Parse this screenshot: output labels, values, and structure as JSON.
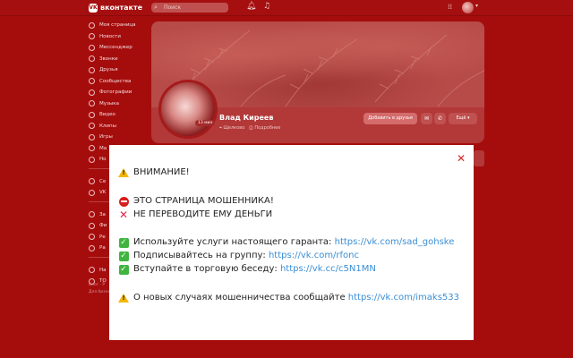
{
  "topbar": {
    "logo_mark": "VK",
    "logo_text": "вконтакте",
    "search_placeholder": "Поиск",
    "icons": [
      "bell-icon",
      "music-icon",
      "apps-icon",
      "avatar",
      "chevron-down-icon"
    ]
  },
  "sidebar": {
    "group1": [
      {
        "label": "Моя страница"
      },
      {
        "label": "Новости"
      },
      {
        "label": "Мессенджер"
      },
      {
        "label": "Звонки"
      },
      {
        "label": "Друзья"
      },
      {
        "label": "Сообщества"
      },
      {
        "label": "Фотографии"
      },
      {
        "label": "Музыка"
      },
      {
        "label": "Видео"
      },
      {
        "label": "Клипы"
      },
      {
        "label": "Игры"
      },
      {
        "label": "Ма"
      },
      {
        "label": "Но"
      }
    ],
    "group2": [
      {
        "label": "Се"
      },
      {
        "label": "VK"
      }
    ],
    "group3": [
      {
        "label": "За"
      },
      {
        "label": "Фи"
      },
      {
        "label": "Ре"
      },
      {
        "label": "Ра"
      }
    ],
    "group4": [
      {
        "label": "На"
      },
      {
        "label": "ТО"
      }
    ],
    "footer_line1": "Блог · Р",
    "footer_line2": "Для бизнеса"
  },
  "profile": {
    "name": "Влад Киреев",
    "location": "Щелково",
    "details_link": "Подробнее",
    "avatar_badge": "13 мин",
    "add_friend_label": "Добавить в друзья",
    "more_label": "Ещё"
  },
  "modal": {
    "title": "ВНИМАНИЕ!",
    "fraud_line": "ЭТО СТРАНИЦА МОШЕННИКА!",
    "no_money_line": "НЕ ПЕРЕВОДИТЕ ЕМУ ДЕНЬГИ",
    "tip1_text": "Используйте услуги настоящего гаранта: ",
    "tip1_link": "https://vk.com/sad_gohske",
    "tip2_text": "Подписывайтесь на группу: ",
    "tip2_link": "https://vk.com/rfonc",
    "tip3_text": "Вступайте в торговую беседу: ",
    "tip3_link": "https://vk.cc/c5N1MN",
    "report_text": "О новых случаях мошенничества сообщайте ",
    "report_link": "https://vk.com/imaks533"
  },
  "colors": {
    "overlay_red": "#a50d0d",
    "link": "#3a8ed6",
    "check_green": "#3fb43f",
    "close_red": "#d22626"
  }
}
